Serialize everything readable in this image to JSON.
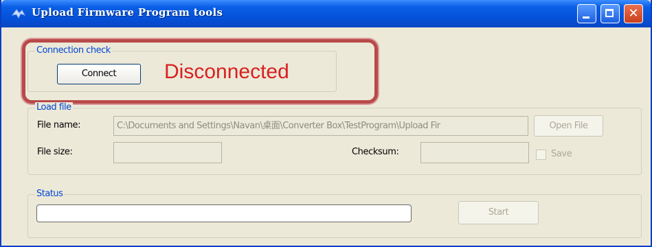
{
  "window": {
    "title": "Upload Firmware Program tools",
    "title_icon": "app-icon",
    "controls": {
      "minimize_icon": "minimize-icon",
      "maximize_icon": "maximize-icon",
      "close_icon": "close-icon",
      "close_glyph": "✕"
    }
  },
  "connection": {
    "legend": "Connection check",
    "connect_label": "Connect",
    "status": "Disconnected",
    "status_color": "#d92020"
  },
  "load_file": {
    "legend": "Load file",
    "file_name_label": "File name:",
    "file_name_value": "C:\\Documents and Settings\\Navan\\桌面\\Converter Box\\TestProgram\\Upload Fir",
    "open_file_label": "Open File",
    "file_size_label": "File size:",
    "file_size_value": "",
    "checksum_label": "Checksum:",
    "checksum_value": "",
    "save_label": "Save",
    "save_checked": false
  },
  "status": {
    "legend": "Status",
    "progress": 0,
    "start_label": "Start"
  },
  "colors": {
    "titlebar": "#0550d8",
    "legend": "#0046d5",
    "highlight": "#b84a4a",
    "window_bg": "#ece9d8"
  }
}
